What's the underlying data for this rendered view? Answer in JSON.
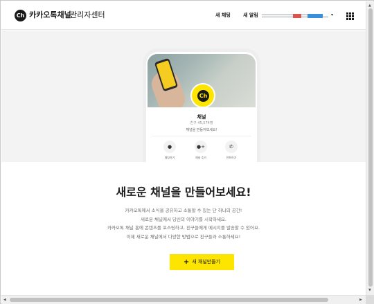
{
  "header": {
    "logo_icon": "Ch",
    "logo_text": "카카오톡채널",
    "logo_sub": "관리자센터",
    "nav_chat": "새 채팅",
    "nav_alert": "새 알림",
    "account_caret": "▾",
    "menu_icon": "grid-menu-icon"
  },
  "preview": {
    "avatar_text": "Ch",
    "channel_name": "채널",
    "friends": "친구 45,574명",
    "description": "채널을 만들어보세요!",
    "actions": [
      {
        "icon": "chat-bubble-icon",
        "glyph": "●",
        "label": "채팅하기"
      },
      {
        "icon": "add-friend-icon",
        "glyph": "●+",
        "label": "채널 추가"
      },
      {
        "icon": "phone-icon",
        "glyph": "✆",
        "label": "전화하기"
      }
    ]
  },
  "main": {
    "headline": "새로운 채널을 만들어보세요!",
    "lines": [
      "카카오톡에서 소식을 공유하고 소통할 수 있는 단 하나의 공간!",
      "새로운 채널에서 당신의 이야기를 시작하세요.",
      "카카오톡 채널 홈에 콘텐츠를 포스팅하고, 친구들에게 메시지를 발송할 수 있어요.",
      "이제 새로운 채널에서 다양한 방법으로 친구들과 소통하세요!"
    ],
    "create_button": "새 채널만들기",
    "create_button_icon": "+"
  },
  "scrollbars": {
    "up": "▲",
    "down": "▼",
    "left": "◀",
    "right": "▶"
  },
  "colors": {
    "brand_yellow": "#fee500",
    "text_dark": "#191919",
    "band_gray": "#f3f3f3"
  }
}
